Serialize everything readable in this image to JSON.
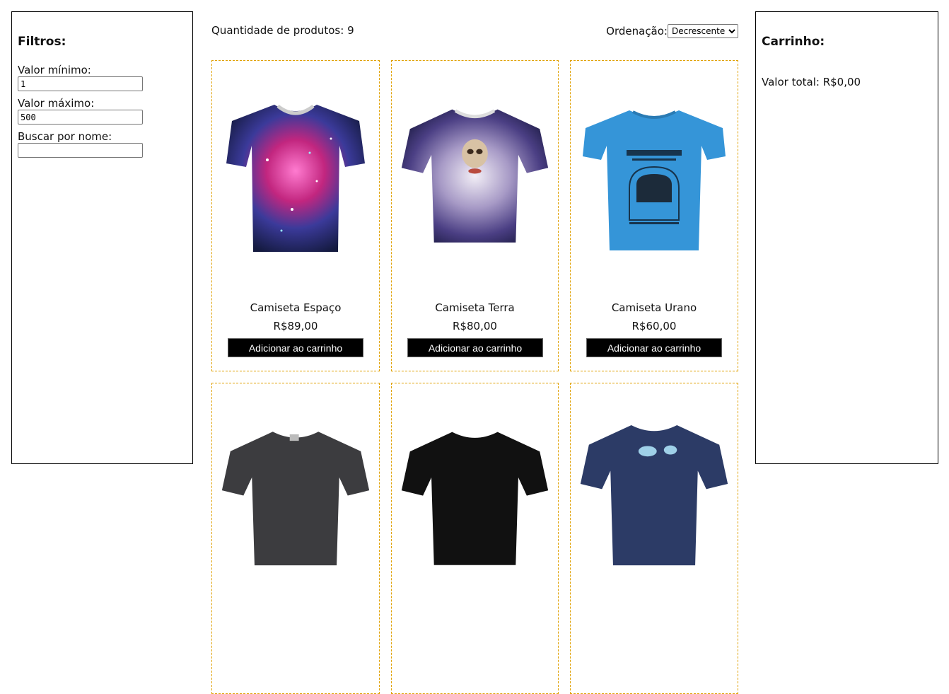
{
  "filters": {
    "title": "Filtros:",
    "min_label": "Valor mínimo:",
    "min_value": "1",
    "max_label": "Valor máximo:",
    "max_value": "500",
    "name_label": "Buscar por nome:",
    "name_value": ""
  },
  "products_header": {
    "count_text": "Quantidade de produtos: 9",
    "sort_label": "Ordenação:",
    "sort_selected": "Decrescente"
  },
  "products": [
    {
      "name": "Camiseta Espaço",
      "price": "R$89,00",
      "button": "Adicionar ao carrinho"
    },
    {
      "name": "Camiseta Terra",
      "price": "R$80,00",
      "button": "Adicionar ao carrinho"
    },
    {
      "name": "Camiseta Urano",
      "price": "R$60,00",
      "button": "Adicionar ao carrinho"
    },
    {
      "name": "",
      "price": "",
      "button": ""
    },
    {
      "name": "",
      "price": "",
      "button": ""
    },
    {
      "name": "",
      "price": "",
      "button": ""
    }
  ],
  "cart": {
    "title": "Carrinho:",
    "total": "Valor total: R$0,00"
  }
}
